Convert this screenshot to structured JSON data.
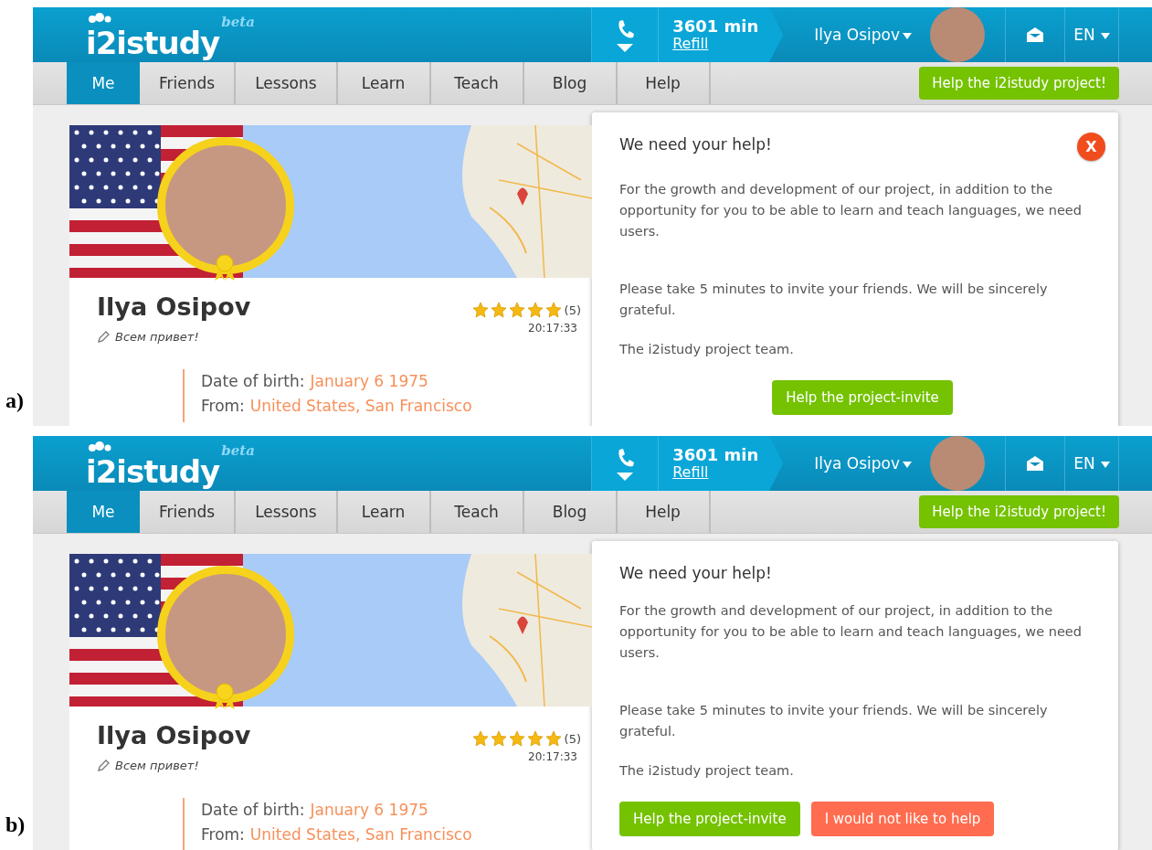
{
  "panels": [
    {
      "label": "a)",
      "header": {
        "logo": "i2istudy",
        "logo_tag": "beta",
        "minutes": "3601 min",
        "refill": "Refill",
        "user": "Ilya Osipov",
        "language": "EN"
      },
      "nav": {
        "tabs": [
          {
            "label": "Me",
            "selected": true
          },
          {
            "label": "Friends",
            "selected": false
          },
          {
            "label": "Lessons",
            "selected": false
          },
          {
            "label": "Learn",
            "selected": false
          },
          {
            "label": "Teach",
            "selected": false
          },
          {
            "label": "Blog",
            "selected": false
          },
          {
            "label": "Help",
            "selected": false
          }
        ],
        "cta": "Help the i2istudy project!"
      },
      "profile": {
        "name": "Ilya Osipov",
        "status": "Всем привет!",
        "stars": 5,
        "rating_count": "(5)",
        "local_time": "20:17:33",
        "details": [
          {
            "label": "Date of birth:",
            "value": "January 6 1975"
          },
          {
            "label": "From:",
            "value": "United States, San Francisco"
          }
        ]
      },
      "modal": {
        "title": "We need your help!",
        "close": "X",
        "paragraphs": [
          "For the growth and development of our project, in addition to the opportunity for you to be able to learn and teach languages, we need users.",
          "Please take 5 minutes to invite your friends. We will be sincerely grateful.",
          "The i2istudy project team."
        ],
        "buttons": [
          {
            "label": "Help the project-invite",
            "kind": "accept"
          }
        ]
      }
    },
    {
      "label": "b)",
      "header": {
        "logo": "i2istudy",
        "logo_tag": "beta",
        "minutes": "3601 min",
        "refill": "Refill",
        "user": "Ilya Osipov",
        "language": "EN"
      },
      "nav": {
        "tabs": [
          {
            "label": "Me",
            "selected": true
          },
          {
            "label": "Friends",
            "selected": false
          },
          {
            "label": "Lessons",
            "selected": false
          },
          {
            "label": "Learn",
            "selected": false
          },
          {
            "label": "Teach",
            "selected": false
          },
          {
            "label": "Blog",
            "selected": false
          },
          {
            "label": "Help",
            "selected": false
          }
        ],
        "cta": "Help the i2istudy project!"
      },
      "profile": {
        "name": "Ilya Osipov",
        "status": "Всем привет!",
        "stars": 5,
        "rating_count": "(5)",
        "local_time": "20:17:33",
        "details": [
          {
            "label": "Date of birth:",
            "value": "January 6 1975"
          },
          {
            "label": "From:",
            "value": "United States, San Francisco"
          }
        ]
      },
      "modal": {
        "title": "We need your help!",
        "paragraphs": [
          "For the growth and development of our project, in addition to the opportunity for you to be able to learn and teach languages, we need users.",
          "Please take 5 minutes to invite your friends. We will be sincerely grateful.",
          "The i2istudy project team."
        ],
        "buttons": [
          {
            "label": "Help the project-invite",
            "kind": "accept"
          },
          {
            "label": "I would not like to help",
            "kind": "decline"
          }
        ]
      }
    }
  ]
}
